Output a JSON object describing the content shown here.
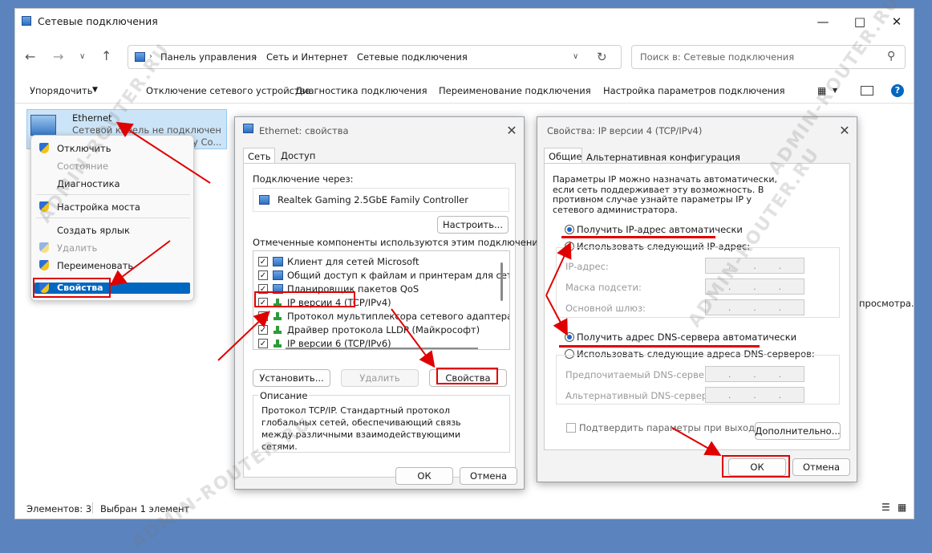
{
  "window": {
    "title": "Сетевые подключения"
  },
  "address": {
    "crumbs": [
      "Панель управления",
      "Сеть и Интернет",
      "Сетевые подключения"
    ],
    "search_placeholder": "Поиск в: Сетевые подключения"
  },
  "toolbar": {
    "organize": "Упорядочить",
    "items": [
      "Отключение сетевого устройства",
      "Диагностика подключения",
      "Переименование подключения",
      "Настройка параметров подключения"
    ]
  },
  "adapter": {
    "name": "Ethernet",
    "status": "Сетевой кабель не подключен",
    "device": "y Co..."
  },
  "context_menu": {
    "items": [
      {
        "label": "Отключить",
        "disabled": false
      },
      {
        "label": "Состояние",
        "disabled": true
      },
      {
        "label": "Диагностика",
        "disabled": false
      },
      {
        "label": "Настройка моста",
        "disabled": false
      },
      {
        "label": "Создать ярлык",
        "disabled": false
      },
      {
        "label": "Удалить",
        "disabled": true
      },
      {
        "label": "Переименовать",
        "disabled": false
      },
      {
        "label": "Свойства",
        "disabled": false
      }
    ]
  },
  "status_bar": {
    "count": "Элементов: 3",
    "selected": "Выбран 1 элемент"
  },
  "preview_text": "просмотра.",
  "eth_dialog": {
    "title": "Ethernet: свойства",
    "tabs": [
      "Сеть",
      "Доступ"
    ],
    "connect_via_label": "Подключение через:",
    "adapter_name": "Realtek Gaming 2.5GbE Family Controller",
    "configure": "Настроить...",
    "components_label": "Отмеченные компоненты используются этим подключением:",
    "components": [
      {
        "label": "Клиент для сетей Microsoft",
        "checked": true
      },
      {
        "label": "Общий доступ к файлам и принтерам для сетей Mi",
        "checked": true
      },
      {
        "label": "Планировщик пакетов QoS",
        "checked": true
      },
      {
        "label": "IP версии 4 (TCP/IPv4)",
        "checked": true
      },
      {
        "label": "Протокол мультиплексора сетевого адаптера (Май",
        "checked": false
      },
      {
        "label": "Драйвер протокола LLDP (Майкрософт)",
        "checked": true
      },
      {
        "label": "IP версии 6 (TCP/IPv6)",
        "checked": true
      }
    ],
    "install": "Установить...",
    "remove": "Удалить",
    "properties": "Свойства",
    "description_title": "Описание",
    "description": "Протокол TCP/IP. Стандартный протокол глобальных сетей, обеспечивающий связь между различными взаимодействующими сетями.",
    "ok": "ОК",
    "cancel": "Отмена"
  },
  "ipv4_dialog": {
    "title": "Свойства: IP версии 4 (TCP/IPv4)",
    "tabs": [
      "Общие",
      "Альтернативная конфигурация"
    ],
    "intro": "Параметры IP можно назначать автоматически, если сеть поддерживает эту возможность. В противном случае узнайте параметры IP у сетевого администратора.",
    "auto_ip": "Получить IP-адрес автоматически",
    "manual_ip": "Использовать следующий IP-адрес:",
    "ip_label": "IP-адрес:",
    "mask_label": "Маска подсети:",
    "gateway_label": "Основной шлюз:",
    "auto_dns": "Получить адрес DNS-сервера автоматически",
    "manual_dns": "Использовать следующие адреса DNS-серверов:",
    "pref_dns_label": "Предпочитаемый DNS-сервер:",
    "alt_dns_label": "Альтернативный DNS-сервер:",
    "validate": "Подтвердить параметры при выходе",
    "advanced": "Дополнительно...",
    "ok": "ОК",
    "cancel": "Отмена"
  },
  "watermark": "ADMIN-ROUTER.RU",
  "colors": {
    "arrow": "#e00000",
    "accent": "#0067c0",
    "selection": "#cce4f7"
  }
}
